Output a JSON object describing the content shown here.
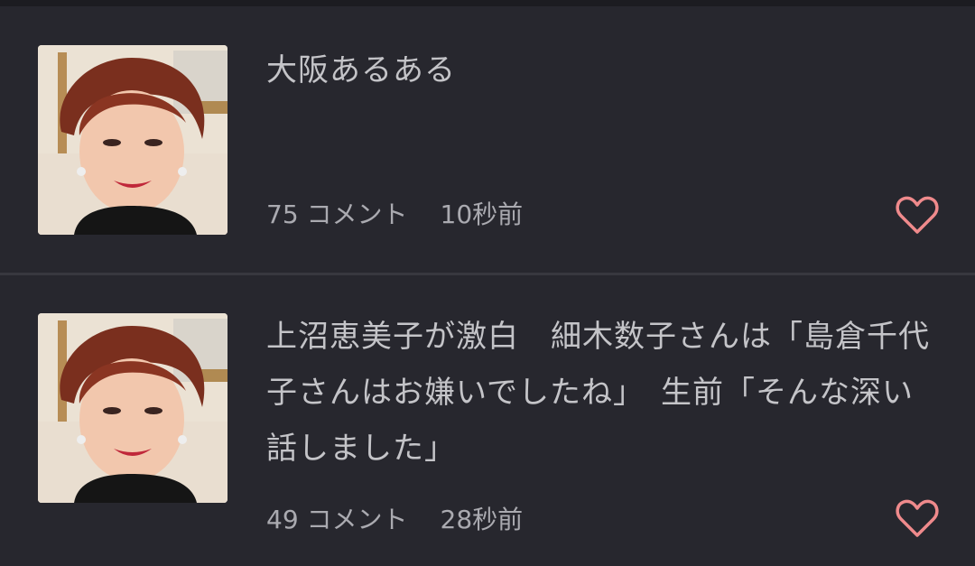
{
  "feed": {
    "items": [
      {
        "title": "大阪あるある",
        "comments": "75 コメント",
        "time": "10秒前",
        "thumbnail_icon": "person-photo",
        "like_icon": "heart-outline-icon"
      },
      {
        "title": "上沼恵美子が激白　細木数子さんは「島倉千代子さんはお嫌いでしたね」　生前「そんな深い話しました」",
        "comments": "49 コメント",
        "time": "28秒前",
        "thumbnail_icon": "person-photo",
        "like_icon": "heart-outline-icon"
      }
    ]
  },
  "colors": {
    "background": "#27272e",
    "title_text": "#c4c4c8",
    "meta_text": "#aaaab0",
    "heart": "#ef8a8c",
    "divider": "#38383f"
  }
}
